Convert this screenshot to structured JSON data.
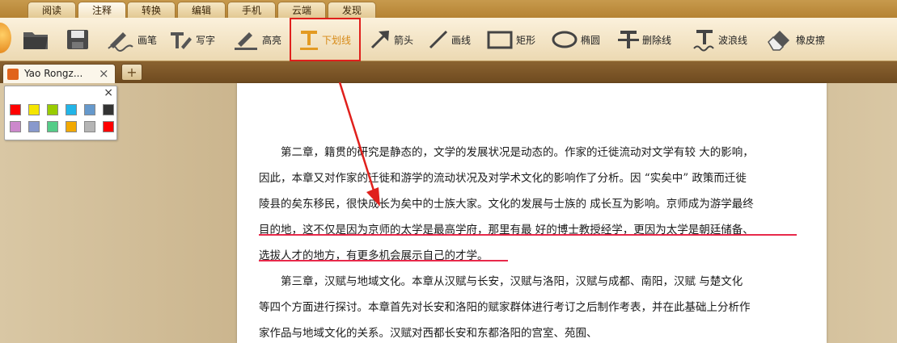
{
  "menu_tabs": [
    {
      "label": "阅读"
    },
    {
      "label": "注释"
    },
    {
      "label": "转换"
    },
    {
      "label": "编辑"
    },
    {
      "label": "手机"
    },
    {
      "label": "云端"
    },
    {
      "label": "发现"
    }
  ],
  "toolbar": {
    "pen": "画笔",
    "typewriter": "写字",
    "highlight": "高亮",
    "underline": "下划线",
    "arrow": "箭头",
    "line": "画线",
    "rectangle": "矩形",
    "ellipse": "椭圆",
    "strikeout": "删除线",
    "squiggly": "波浪线",
    "eraser": "橡皮擦"
  },
  "document_tab": {
    "title": "Yao Rongz...",
    "close": "×"
  },
  "new_tab": "+",
  "palette": {
    "close": "×",
    "colors": [
      "#ff0000",
      "#f5e600",
      "#99cc00",
      "#22b5e8",
      "#6699cc",
      "#333333",
      "#cc88cc",
      "#8899cc",
      "#55cc88",
      "#f2a900",
      "#b5b5b5",
      "#ff0000"
    ]
  },
  "document": {
    "lines": [
      "　　第二章，籍贯的研究是静态的，文学的发展状况是动态的。作家的迁徙流动对文学有较 大的影响，",
      "因此，本章又对作家的迁徙和游学的流动状况及对学术文化的影响作了分析。因 “实矣中” 政策而迁徙",
      "陵县的矣东移民，很快成长为矣中的士族大家。文化的发展与士族的 成长互为影响。京师成为游学最终",
      "目的地，这不仅是因为京师的太学是最高学府，那里有最 好的博士教授经学，更因为太学是朝廷储备、",
      "选拔人才的地方，有更多机会展示自己的才学。",
      "　　第三章，汉赋与地域文化。本章从汉赋与长安，汉赋与洛阳，汉赋与成都、南阳，汉赋 与楚文化",
      "等四个方面进行探讨。本章首先对长安和洛阳的赋家群体进行考订之后制作考表，并在此基础上分析作",
      "家作品与地域文化的关系。汉赋对西都长安和东都洛阳的宫室、苑囿、"
    ]
  }
}
